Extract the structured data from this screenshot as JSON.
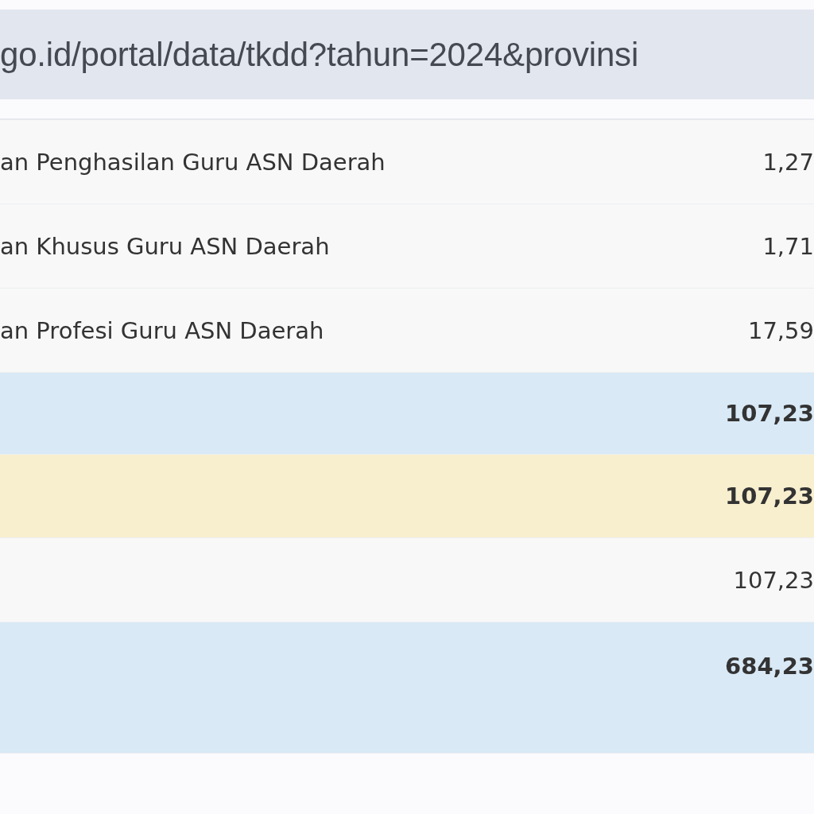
{
  "address_bar": {
    "url": "go.id/portal/data/tkdd?tahun=2024&provinsi"
  },
  "table": {
    "rows": [
      {
        "kind": "item",
        "label": "an Penghasilan Guru ASN Daerah",
        "value": "1,27"
      },
      {
        "kind": "item",
        "label": "an Khusus Guru ASN Daerah",
        "value": "1,71"
      },
      {
        "kind": "item",
        "label": "an Profesi Guru ASN Daerah",
        "value": "17,59"
      },
      {
        "kind": "subtotal",
        "value": "107,23"
      },
      {
        "kind": "total",
        "value": "107,23"
      },
      {
        "kind": "item",
        "value": "107,23"
      },
      {
        "kind": "grand",
        "value": "684,23"
      }
    ]
  }
}
